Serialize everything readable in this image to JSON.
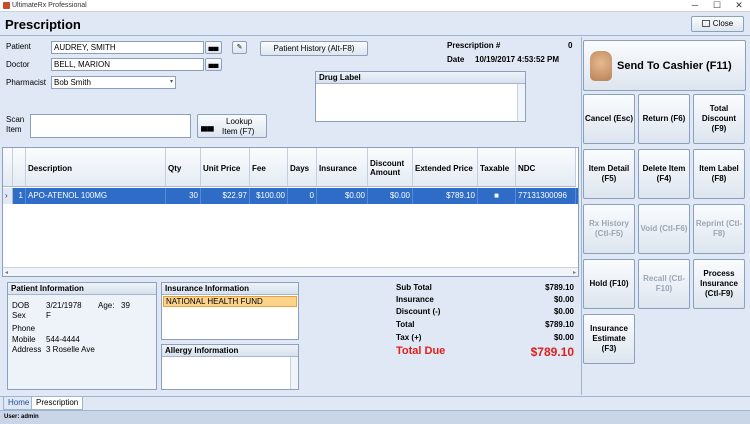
{
  "window": {
    "app_title": "UltimateRx Professional",
    "minimize": "─",
    "maximize": "☐",
    "close": "✕"
  },
  "header": {
    "title": "Prescription",
    "close_label": "Close"
  },
  "patient": {
    "patient_label": "Patient",
    "patient_value": "AUDREY, SMITH",
    "doctor_label": "Doctor",
    "doctor_value": "BELL, MARION",
    "pharmacist_label": "Pharmacist",
    "pharmacist_value": "Bob Smith",
    "history_button": "Patient History (Alt-F8)"
  },
  "prescription": {
    "number_label": "Prescription #",
    "number_value": "0",
    "date_label": "Date",
    "date_value": "10/19/2017 4:53:52 PM"
  },
  "drug_label": {
    "title": "Drug Label"
  },
  "scan": {
    "label_line1": "Scan",
    "label_line2": "Item",
    "lookup_line1": "Lookup",
    "lookup_line2": "Item (F7)"
  },
  "table": {
    "headers": [
      "Description",
      "Qty",
      "Unit Price",
      "Fee",
      "Days",
      "Insurance",
      "Discount Amount",
      "Extended Price",
      "Taxable",
      "NDC"
    ],
    "rows": [
      {
        "index": "1",
        "description": "APO-ATENOL 100MG",
        "qty": "30",
        "unit_price": "$22.97",
        "fee": "$100.00",
        "days": "0",
        "insurance": "$0.00",
        "discount": "$0.00",
        "extended": "$789.10",
        "taxable": "■",
        "ndc": "77131300096"
      }
    ]
  },
  "patient_info": {
    "title": "Patient Information",
    "dob_label": "DOB",
    "dob_value": "3/21/1978",
    "age_label": "Age:",
    "age_value": "39",
    "sex_label": "Sex",
    "sex_value": "F",
    "phone_label": "Phone",
    "phone_value": "",
    "mobile_label": "Mobile",
    "mobile_value": "544-4444",
    "address_label": "Address",
    "address_value": "3 Roselle Ave"
  },
  "insurance_info": {
    "title": "Insurance Information",
    "items": [
      "NATIONAL HEALTH FUND"
    ]
  },
  "allergy_info": {
    "title": "Allergy  Information"
  },
  "totals": {
    "subtotal_label": "Sub Total",
    "subtotal_value": "$789.10",
    "insurance_label": "Insurance",
    "insurance_value": "$0.00",
    "discount_label": "Discount (-)",
    "discount_value": "$0.00",
    "total_label": "Total",
    "total_value": "$789.10",
    "tax_label": "Tax (+)",
    "tax_value": "$0.00",
    "due_label": "Total Due",
    "due_value": "$789.10"
  },
  "actions": {
    "send_to_cashier": "Send To Cashier (F11)",
    "cancel": "Cancel (Esc)",
    "return": "Return (F6)",
    "total_discount": "Total Discount (F9)",
    "item_detail": "Item Detail (F5)",
    "delete_item": "Delete Item (F4)",
    "item_label": "Item Label (F8)",
    "rx_history": "Rx History (Ctl-F5)",
    "void": "Void (Ctl-F6)",
    "reprint": "Reprint (Ctl-F8)",
    "hold": "Hold (F10)",
    "recall": "Recall (Ctl-F10)",
    "process_insurance": "Process Insurance (Ctl-F9)",
    "insurance_estimate": "Insurance Estimate (F3)"
  },
  "tabs": [
    "Home",
    "Prescription"
  ],
  "status": {
    "user": "User: admin"
  },
  "colors": {
    "selection": "#2f6cc7",
    "total_due": "#e0201b",
    "background": "#dfe8f4"
  }
}
